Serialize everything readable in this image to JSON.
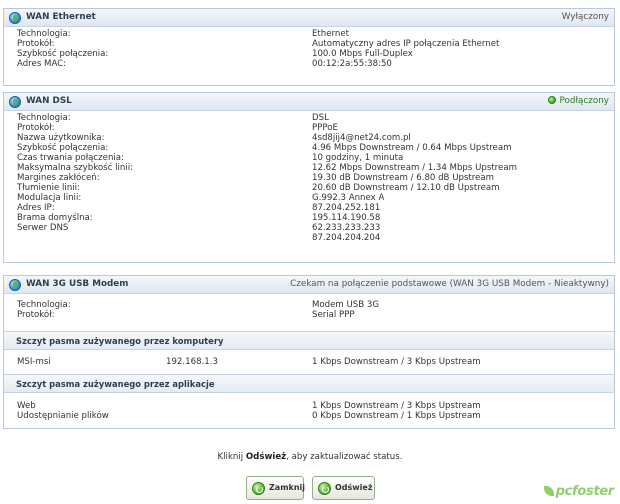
{
  "wan_ethernet": {
    "title": "WAN Ethernet",
    "status": "Wyłączony",
    "rows": [
      {
        "k": "Technologia:",
        "v": "Ethernet"
      },
      {
        "k": "Protokół:",
        "v": "Automatyczny adres IP połączenia Ethernet"
      },
      {
        "k": "Szybkość połączenia:",
        "v": "100.0 Mbps Full-Duplex"
      },
      {
        "k": "Adres MAC:",
        "v": "00:12:2a:55:38:50"
      }
    ]
  },
  "wan_dsl": {
    "title": "WAN DSL",
    "status": "Podłączony",
    "rows": [
      {
        "k": "Technologia:",
        "v": "DSL"
      },
      {
        "k": "Protokół:",
        "v": "PPPoE"
      },
      {
        "k": "Nazwa użytkownika:",
        "v": "4sd8jij4@net24.com.pl"
      },
      {
        "k": "Szybkość połączenia:",
        "v": "4.96 Mbps Downstream / 0.64 Mbps Upstream"
      },
      {
        "k": "Czas trwania połączenia:",
        "v": "10 godziny, 1 minuta"
      },
      {
        "k": "Maksymalna szybkość linii:",
        "v": "12.62 Mbps Downstream / 1.34 Mbps Upstream"
      },
      {
        "k": "Margines zakłóceń:",
        "v": "19.30 dB Downstream / 6.80 dB Upstream"
      },
      {
        "k": "Tłumienie linii:",
        "v": "20.60 dB Downstream / 12.10 dB Upstream"
      },
      {
        "k": "Modulacja linii:",
        "v": "G.992.3 Annex A"
      },
      {
        "k": "Adres IP:",
        "v": "87.204.252.181"
      },
      {
        "k": "Brama domyślna:",
        "v": "195.114.190.58"
      },
      {
        "k": "Serwer DNS",
        "v": "62.233.233.233"
      },
      {
        "k": "",
        "v": "87.204.204.204"
      }
    ]
  },
  "wan_3g": {
    "title": "WAN 3G USB Modem",
    "status": "Czekam na połączenie podstawowe (WAN 3G USB Modem - Nieaktywny)",
    "rows": [
      {
        "k": "Technologia:",
        "v": "Modem USB 3G"
      },
      {
        "k": "Protokół:",
        "v": "Serial PPP"
      }
    ]
  },
  "peak_computers": {
    "title": "Szczyt pasma zużywanego przez komputery",
    "rows": [
      {
        "k": "MSI-msi",
        "m": "192.168.1.3",
        "v": "1 Kbps Downstream / 3 Kbps Upstream"
      }
    ]
  },
  "peak_apps": {
    "title": "Szczyt pasma zużywanego przez aplikacje",
    "rows": [
      {
        "k": "Web",
        "v": "1 Kbps Downstream / 3 Kbps Upstream"
      },
      {
        "k": "Udostępnianie plików",
        "v": "0 Kbps Downstream / 1 Kbps Upstream"
      }
    ]
  },
  "footer": {
    "pre": "Kliknij ",
    "bold": "Odśwież",
    "post": ", aby zaktualizować status."
  },
  "buttons": {
    "close": "Zamknij",
    "refresh": "Odśwież"
  },
  "logo": "pcfoster",
  "colors": {
    "status_ok": "#2c7a1e",
    "panel_border": "#b9c9da",
    "logo": "#8fd06c"
  }
}
